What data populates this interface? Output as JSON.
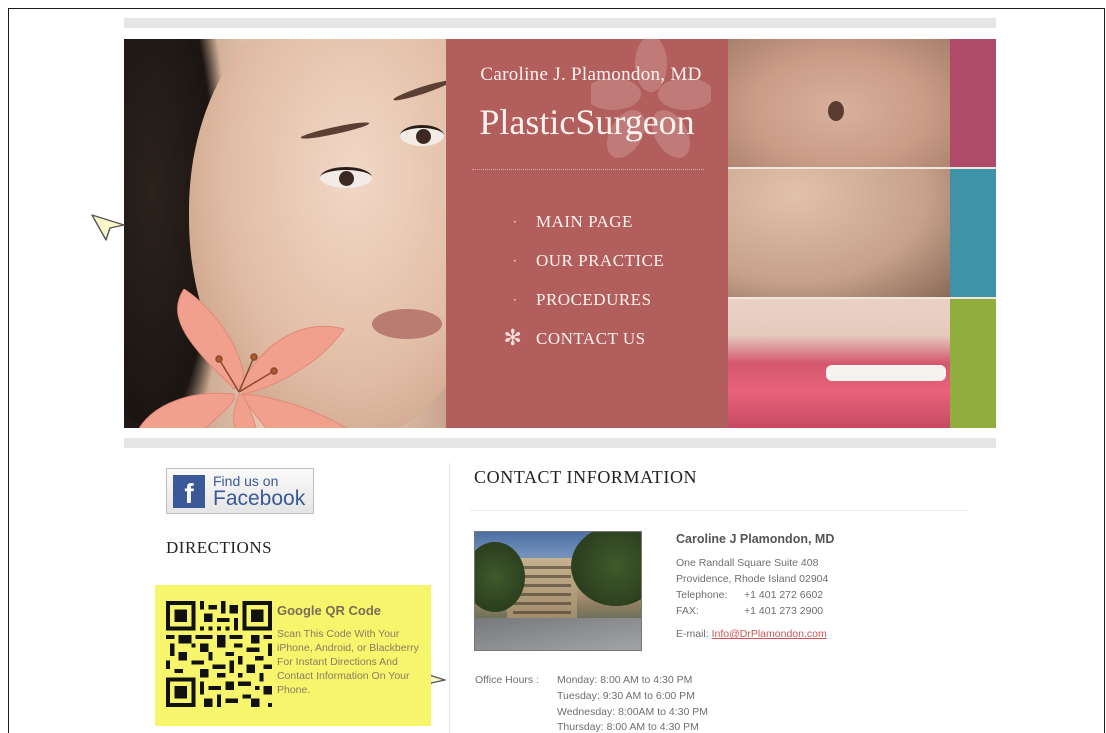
{
  "header": {
    "doctor_name": "Caroline J. Plamondon, MD",
    "specialty_part1": "Plastic",
    "specialty_part2": "Surgeon"
  },
  "nav": [
    {
      "label": "MAIN PAGE"
    },
    {
      "label": "OUR PRACTICE"
    },
    {
      "label": "PROCEDURES"
    },
    {
      "label": "CONTACT US"
    }
  ],
  "sidebar": {
    "facebook_small": "Find us on",
    "facebook_big": "Facebook",
    "directions": "DIRECTIONS",
    "qr_title": "Google QR Code",
    "qr_text": "Scan This Code With Your iPhone, Android, or Blackberry For Instant Directions And Contact Information On Your Phone."
  },
  "contact": {
    "title": "CONTACT  INFORMATION",
    "name": "Caroline J Plamondon, MD",
    "address1": "One Randall Square Suite 408",
    "address2": "Providence, Rhode Island 02904",
    "telephone_label": "Telephone:",
    "telephone": "+1 401 272 6602",
    "fax_label": "FAX:",
    "fax": "+1 401 273 2900",
    "email_label": "E-mail:",
    "email": "Info@DrPlamondon.com",
    "hours_label": "Office Hours :",
    "hours": [
      "Monday: 8:00 AM to 4:30 PM",
      "Tuesday: 9:30 AM to 6:00 PM",
      "Wednesday: 8:00AM to 4:30 PM",
      "Thursday: 8:00 AM to 4:30 PM"
    ]
  },
  "colors": {
    "header_panel": "#b25e5c",
    "strip_pink": "#b04a69",
    "strip_teal": "#3f93a9",
    "strip_green": "#8fae3e",
    "qr_background": "#f7f56b",
    "facebook_blue": "#3b5998"
  },
  "icons": {
    "nav_bullet": "dot-icon",
    "nav_active": "flower-star-icon",
    "cursor": "cursor-arrow-icon"
  }
}
